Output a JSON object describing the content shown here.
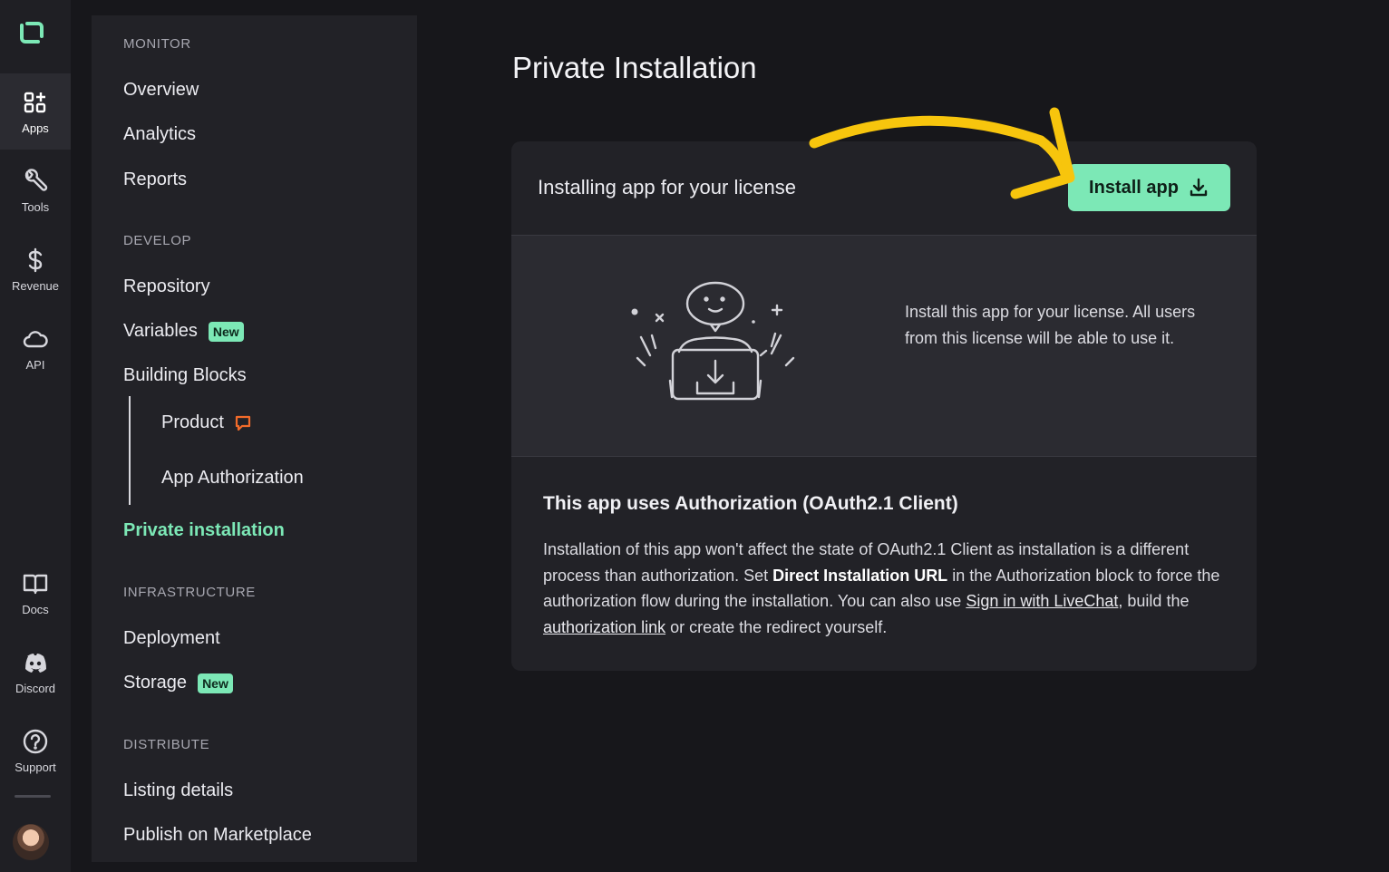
{
  "rail": {
    "items": [
      {
        "label": "Apps",
        "icon": "apps-grid-icon",
        "active": true
      },
      {
        "label": "Tools",
        "icon": "wrench-icon"
      },
      {
        "label": "Revenue",
        "icon": "dollar-icon"
      },
      {
        "label": "API",
        "icon": "cloud-icon"
      },
      {
        "label": "Docs",
        "icon": "book-icon"
      },
      {
        "label": "Discord",
        "icon": "discord-icon"
      },
      {
        "label": "Support",
        "icon": "help-icon"
      }
    ]
  },
  "sidenav": {
    "sections": {
      "monitor": "MONITOR",
      "develop": "DEVELOP",
      "infrastructure": "INFRASTRUCTURE",
      "distribute": "DISTRIBUTE"
    },
    "items": {
      "overview": "Overview",
      "analytics": "Analytics",
      "reports": "Reports",
      "repository": "Repository",
      "variables": "Variables",
      "building_blocks": "Building Blocks",
      "product": "Product",
      "app_authorization": "App Authorization",
      "private_installation": "Private installation",
      "deployment": "Deployment",
      "storage": "Storage",
      "listing_details": "Listing details",
      "publish": "Publish on Marketplace"
    },
    "badge_new": "New"
  },
  "main": {
    "title": "Private Installation",
    "card": {
      "header": "Installing app for your license",
      "install_button": "Install app",
      "description": "Install this app for your license. All users from this license will be able to use it.",
      "auth_title": "This app uses Authorization (OAuth2.1 Client)",
      "auth_text_1": "Installation of this app won't affect the state of OAuth2.1 Client as installation is a different process than authorization. Set ",
      "auth_bold": "Direct Installation URL",
      "auth_text_2": " in the Authorization block to force the authorization flow during the installation. You can also use ",
      "auth_link_1": "Sign in with LiveChat",
      "auth_text_3": ", build the ",
      "auth_link_2": "authorization link",
      "auth_text_4": " or create the redirect yourself."
    }
  },
  "colors": {
    "accent": "#7ce8b6",
    "annotation_arrow": "#f7c50d",
    "warning_icon": "#f26b2a"
  }
}
